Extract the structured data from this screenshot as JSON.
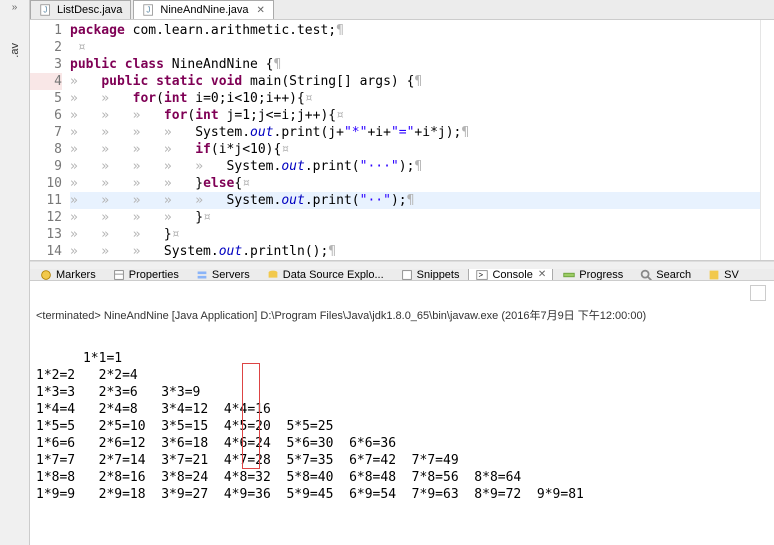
{
  "leftRail": {
    "arrow": "»",
    "vtab": ".av"
  },
  "tabs": [
    {
      "label": "ListDesc.java",
      "active": false
    },
    {
      "label": "NineAndNine.java",
      "active": true
    }
  ],
  "code": {
    "lines": [
      {
        "n": "1",
        "segs": [
          {
            "t": "package",
            "c": "kw"
          },
          {
            "t": " com.learn.arithmetic.test;",
            "c": ""
          },
          {
            "t": "¶",
            "c": "ws"
          }
        ]
      },
      {
        "n": "2",
        "segs": [
          {
            "t": " ",
            "c": ""
          },
          {
            "t": "¤",
            "c": "ws"
          }
        ]
      },
      {
        "n": "3",
        "segs": [
          {
            "t": "public class ",
            "c": "kw"
          },
          {
            "t": "NineAndNine {",
            "c": ""
          },
          {
            "t": "¶",
            "c": "ws"
          }
        ]
      },
      {
        "n": "4",
        "err": true,
        "segs": [
          {
            "t": "»   ",
            "c": "ws"
          },
          {
            "t": "public static void ",
            "c": "kw"
          },
          {
            "t": "main(String[] args) {",
            "c": ""
          },
          {
            "t": "¶",
            "c": "ws"
          }
        ]
      },
      {
        "n": "5",
        "segs": [
          {
            "t": "»   »   ",
            "c": "ws"
          },
          {
            "t": "for",
            "c": "kw"
          },
          {
            "t": "(",
            "c": ""
          },
          {
            "t": "int",
            "c": "kw"
          },
          {
            "t": " i=0;i<10;i++){",
            "c": ""
          },
          {
            "t": "¤",
            "c": "ws"
          }
        ]
      },
      {
        "n": "6",
        "segs": [
          {
            "t": "»   »   »   ",
            "c": "ws"
          },
          {
            "t": "for",
            "c": "kw"
          },
          {
            "t": "(",
            "c": ""
          },
          {
            "t": "int",
            "c": "kw"
          },
          {
            "t": " j=1;j<=i;j++){",
            "c": ""
          },
          {
            "t": "¤",
            "c": "ws"
          }
        ]
      },
      {
        "n": "7",
        "segs": [
          {
            "t": "»   »   »   »   ",
            "c": "ws"
          },
          {
            "t": "System.",
            "c": ""
          },
          {
            "t": "out",
            "c": "fld"
          },
          {
            "t": ".print(j+",
            "c": ""
          },
          {
            "t": "\"*\"",
            "c": "str"
          },
          {
            "t": "+i+",
            "c": ""
          },
          {
            "t": "\"=\"",
            "c": "str"
          },
          {
            "t": "+i*j);",
            "c": ""
          },
          {
            "t": "¶",
            "c": "ws"
          }
        ]
      },
      {
        "n": "8",
        "segs": [
          {
            "t": "»   »   »   »   ",
            "c": "ws"
          },
          {
            "t": "if",
            "c": "kw"
          },
          {
            "t": "(i*j<10){",
            "c": ""
          },
          {
            "t": "¤",
            "c": "ws"
          }
        ]
      },
      {
        "n": "9",
        "segs": [
          {
            "t": "»   »   »   »   »   ",
            "c": "ws"
          },
          {
            "t": "System.",
            "c": ""
          },
          {
            "t": "out",
            "c": "fld"
          },
          {
            "t": ".print(",
            "c": ""
          },
          {
            "t": "\"···\"",
            "c": "str"
          },
          {
            "t": ");",
            "c": ""
          },
          {
            "t": "¶",
            "c": "ws"
          }
        ]
      },
      {
        "n": "10",
        "segs": [
          {
            "t": "»   »   »   »   ",
            "c": "ws"
          },
          {
            "t": "}",
            "c": ""
          },
          {
            "t": "else",
            "c": "kw"
          },
          {
            "t": "{",
            "c": ""
          },
          {
            "t": "¤",
            "c": "ws"
          }
        ]
      },
      {
        "n": "11",
        "hl": true,
        "segs": [
          {
            "t": "»   »   »   »   »   ",
            "c": "ws"
          },
          {
            "t": "System.",
            "c": ""
          },
          {
            "t": "out",
            "c": "fld"
          },
          {
            "t": ".print(",
            "c": ""
          },
          {
            "t": "\"··\"",
            "c": "str"
          },
          {
            "t": ");",
            "c": ""
          },
          {
            "t": "¶",
            "c": "ws"
          }
        ]
      },
      {
        "n": "12",
        "segs": [
          {
            "t": "»   »   »   »   ",
            "c": "ws"
          },
          {
            "t": "}",
            "c": ""
          },
          {
            "t": "¤",
            "c": "ws"
          }
        ]
      },
      {
        "n": "13",
        "segs": [
          {
            "t": "»   »   »   ",
            "c": "ws"
          },
          {
            "t": "}",
            "c": ""
          },
          {
            "t": "¤",
            "c": "ws"
          }
        ]
      },
      {
        "n": "14",
        "segs": [
          {
            "t": "»   »   »   ",
            "c": "ws"
          },
          {
            "t": "System.",
            "c": ""
          },
          {
            "t": "out",
            "c": "fld"
          },
          {
            "t": ".println();",
            "c": ""
          },
          {
            "t": "¶",
            "c": "ws"
          }
        ]
      }
    ]
  },
  "bottomTabs": {
    "items": [
      {
        "label": "Markers",
        "icon": "markers"
      },
      {
        "label": "Properties",
        "icon": "props"
      },
      {
        "label": "Servers",
        "icon": "servers"
      },
      {
        "label": "Data Source Explo...",
        "icon": "dse"
      },
      {
        "label": "Snippets",
        "icon": "snip"
      },
      {
        "label": "Console",
        "icon": "console",
        "active": true
      },
      {
        "label": "Progress",
        "icon": "progress"
      },
      {
        "label": "Search",
        "icon": "search"
      },
      {
        "label": "SV",
        "icon": "svn"
      }
    ]
  },
  "console": {
    "status": "<terminated> NineAndNine [Java Application] D:\\Program Files\\Java\\jdk1.8.0_65\\bin\\javaw.exe (2016年7月9日 下午12:00:00)",
    "output": "1*1=1\n1*2=2   2*2=4\n1*3=3   2*3=6   3*3=9\n1*4=4   2*4=8   3*4=12  4*4=16\n1*5=5   2*5=10  3*5=15  4*5=20  5*5=25\n1*6=6   2*6=12  3*6=18  4*6=24  5*6=30  6*6=36\n1*7=7   2*7=14  3*7=21  4*7=28  5*7=35  6*7=42  7*7=49\n1*8=8   2*8=16  3*8=24  4*8=32  5*8=40  6*8=48  7*8=56  8*8=64\n1*9=9   2*9=18  3*9=27  4*9=36  5*9=45  6*9=54  7*9=63  8*9=72  9*9=81"
  }
}
